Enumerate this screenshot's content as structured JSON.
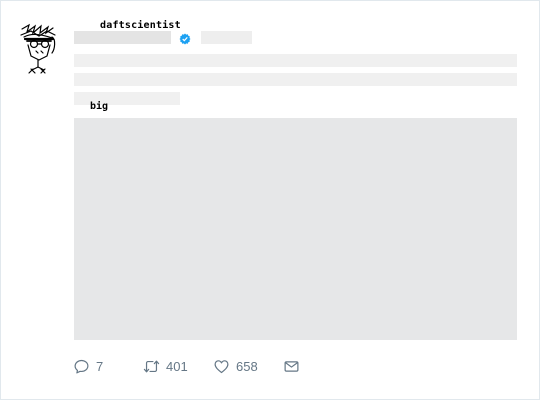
{
  "tweet": {
    "username_overlay": "daftscientist",
    "caption_overlay": "big",
    "counts": {
      "replies": "7",
      "retweets": "401",
      "likes": "658"
    }
  },
  "icons": {
    "avatar": "hand-drawn-scientist-avatar",
    "verified": "verified-badge-icon",
    "reply": "reply-icon",
    "retweet": "retweet-icon",
    "like": "heart-icon",
    "dm": "envelope-icon"
  },
  "colors": {
    "accent": "#1da1f2",
    "icon_gray": "#657786",
    "placeholder": "#f0f0f0",
    "media_placeholder": "#e6e7e8"
  }
}
